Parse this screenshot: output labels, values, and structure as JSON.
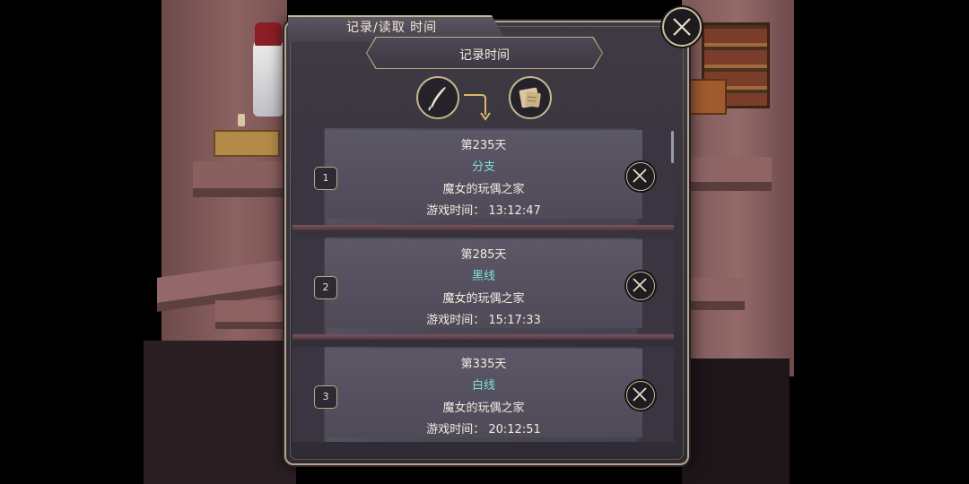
{
  "dialog": {
    "title": "记录/读取 时间",
    "subtitle": "记录时间"
  },
  "icons": {
    "close": "close-x-icon",
    "save": "quill-icon",
    "load": "scroll-icon",
    "arrow": "arrow-down-curve-icon",
    "delete": "delete-x-icon"
  },
  "colors": {
    "route_text": "#7fe0d8",
    "frame_gold": "#c5b48f"
  },
  "slots": [
    {
      "number": "1",
      "day": "第235天",
      "route": "分支",
      "location": "魔女的玩偶之家",
      "playtime": "游戏时间： 13:12:47"
    },
    {
      "number": "2",
      "day": "第285天",
      "route": "黑线",
      "location": "魔女的玩偶之家",
      "playtime": "游戏时间： 15:17:33"
    },
    {
      "number": "3",
      "day": "第335天",
      "route": "白线",
      "location": "魔女的玩偶之家",
      "playtime": "游戏时间： 20:12:51"
    }
  ]
}
